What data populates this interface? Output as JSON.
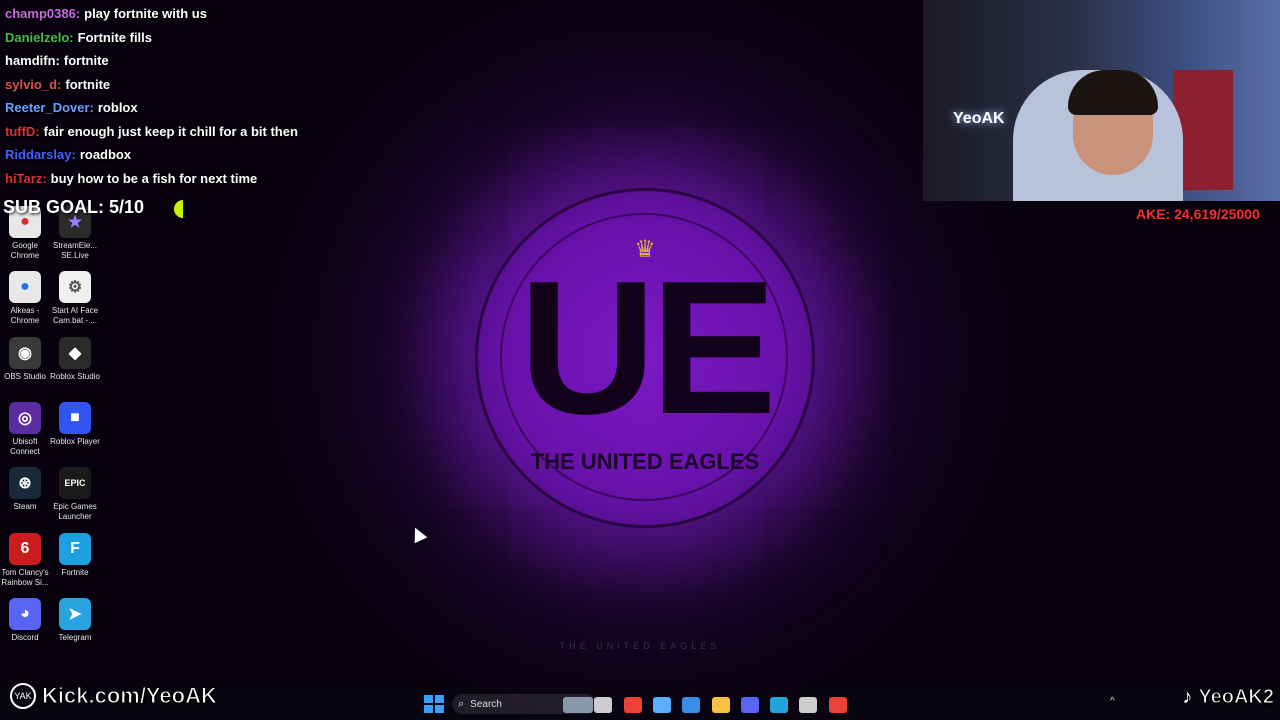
{
  "chat": [
    {
      "user": "champ0386:",
      "message": "play fortnite with us",
      "user_color": "#c86be0"
    },
    {
      "user": "Danielzelo:",
      "message": "Fortnite fills",
      "user_color": "#4db84d"
    },
    {
      "user": "hamdifn:",
      "message": "fortnite",
      "user_color": "#ffffff"
    },
    {
      "user": "sylvio_d:",
      "message": "fortnite",
      "user_color": "#e05050"
    },
    {
      "user": "Reeter_Dover:",
      "message": "roblox",
      "user_color": "#6aa0ff"
    },
    {
      "user": "tuffD:",
      "message": "fair enough just keep it chill for a bit then",
      "user_color": "#e03030"
    },
    {
      "user": "Riddarslay:",
      "message": "roadbox",
      "user_color": "#4060ff"
    },
    {
      "user": "hiTarz:",
      "message": "buy how to be a fish for next time",
      "user_color": "#e03030"
    }
  ],
  "sub_goal": {
    "text": "SUB GOAL: 5/10",
    "color": "#c8f000",
    "progress": 0.5
  },
  "goal_banner": "AKE: 24,619/25000",
  "logo": {
    "letters": "UE",
    "subtitle": "THE UNITED EAGLES"
  },
  "wallpaper_caption": "THE UNITED EAGLES",
  "webcam_sign": "YeoAK",
  "desktop_icons": [
    {
      "label": "Google Chrome",
      "glyph": "●",
      "bg": "#e8e8e8",
      "fg": "#d93025"
    },
    {
      "label": "StreamEle... SE.Live",
      "glyph": "★",
      "bg": "#2b2b2b",
      "fg": "#9a7cff"
    },
    {
      "label": "Alkeas - Chrome",
      "glyph": "●",
      "bg": "#e8e8e8",
      "fg": "#1a73e8"
    },
    {
      "label": "Start AI Face Cam.bat - ...",
      "glyph": "⚙",
      "bg": "#f0f0f0",
      "fg": "#555555"
    },
    {
      "label": "OBS Studio",
      "glyph": "◉",
      "bg": "#3a3a3a",
      "fg": "#ffffff"
    },
    {
      "label": "Roblox Studio",
      "glyph": "◆",
      "bg": "#2a2a2a",
      "fg": "#ffffff"
    },
    {
      "label": "Ubisoft Connect",
      "glyph": "◎",
      "bg": "#5b2ca0",
      "fg": "#ffffff"
    },
    {
      "label": "Roblox Player",
      "glyph": "■",
      "bg": "#3354f4",
      "fg": "#ffffff"
    },
    {
      "label": "Steam",
      "glyph": "⊛",
      "bg": "#1b2838",
      "fg": "#ffffff"
    },
    {
      "label": "Epic Games Launcher",
      "glyph": "EPIC",
      "bg": "#1a1a1a",
      "fg": "#ffffff"
    },
    {
      "label": "Tom Clancy's Rainbow Si...",
      "glyph": "6",
      "bg": "#c81e1e",
      "fg": "#ffffff"
    },
    {
      "label": "Fortnite",
      "glyph": "F",
      "bg": "#1ea0e0",
      "fg": "#ffffff"
    },
    {
      "label": "Discord",
      "glyph": "◕",
      "bg": "#5865f2",
      "fg": "#ffffff"
    },
    {
      "label": "Telegram",
      "glyph": "➤",
      "bg": "#29a3e0",
      "fg": "#ffffff"
    }
  ],
  "kick": {
    "badge": "YAK",
    "text": "Kick.com/YeoAK"
  },
  "tiktok": {
    "text": "YeoAK2"
  },
  "taskbar": {
    "search_label": "Search",
    "apps": [
      {
        "name": "widgets",
        "color": "#8899aa"
      },
      {
        "name": "task-view",
        "color": "#cccccc"
      },
      {
        "name": "chrome",
        "color": "#ea4335"
      },
      {
        "name": "copilot",
        "color": "#5ab0ff"
      },
      {
        "name": "store",
        "color": "#3a8ee6"
      },
      {
        "name": "file-explorer",
        "color": "#f5c242"
      },
      {
        "name": "discord",
        "color": "#5865f2"
      },
      {
        "name": "edge",
        "color": "#1fa5d6"
      },
      {
        "name": "obs",
        "color": "#cccccc"
      },
      {
        "name": "chrome-2",
        "color": "#ea4335"
      }
    ],
    "tray_glyph": "^"
  }
}
